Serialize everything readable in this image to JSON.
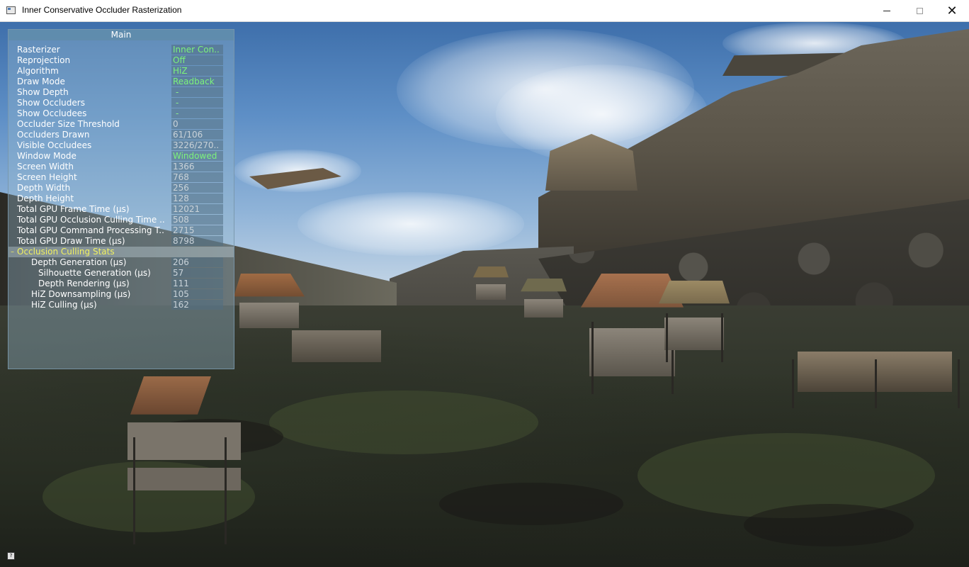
{
  "window": {
    "title": "Inner Conservative Occluder Rasterization",
    "minimize_label": "",
    "maximize_label": "",
    "close_label": "✕"
  },
  "panel": {
    "title": "Main",
    "rows": [
      {
        "label": "Rasterizer",
        "value": "Inner Con.."
      },
      {
        "label": "Reprojection",
        "value": "Off"
      },
      {
        "label": "Algorithm",
        "value": "HiZ"
      },
      {
        "label": "Draw Mode",
        "value": "Readback"
      },
      {
        "label": "Show Depth",
        "value": "-"
      },
      {
        "label": "Show Occluders",
        "value": "-"
      },
      {
        "label": "Show Occludees",
        "value": "-"
      },
      {
        "label": "Occluder Size Threshold",
        "value": "0"
      },
      {
        "label": "Occluders Drawn",
        "value": "61/106"
      },
      {
        "label": "Visible Occludees",
        "value": "3226/270.."
      },
      {
        "label": "Window Mode",
        "value": "Windowed"
      },
      {
        "label": "Screen Width",
        "value": "1366"
      },
      {
        "label": "Screen Height",
        "value": "768"
      },
      {
        "label": "Depth Width",
        "value": "256"
      },
      {
        "label": "Depth Height",
        "value": "128"
      },
      {
        "label": "Total GPU Frame Time (µs)",
        "value": "12021"
      },
      {
        "label": "Total GPU Occlusion Culling Time ..",
        "value": "508"
      },
      {
        "label": "Total GPU Command Processing T..",
        "value": "2715"
      },
      {
        "label": "Total GPU Draw Time (µs)",
        "value": "8798"
      }
    ],
    "section": {
      "label": "Occlusion Culling Stats",
      "rows": [
        {
          "label": "Depth Generation (µs)",
          "value": "206",
          "indent": 1
        },
        {
          "label": "Silhouette Generation (µs)",
          "value": "57",
          "indent": 2
        },
        {
          "label": "Depth Rendering (µs)",
          "value": "111",
          "indent": 2
        },
        {
          "label": "HiZ Downsampling (µs)",
          "value": "105",
          "indent": 1
        },
        {
          "label": "HiZ Culling (µs)",
          "value": "162",
          "indent": 1
        }
      ]
    }
  },
  "help": "?",
  "colors": {
    "value_green": "#7cf27c",
    "value_gray": "#c9d2d8",
    "section_yellow": "#f1f160",
    "panel_header": "#5f8caa"
  }
}
